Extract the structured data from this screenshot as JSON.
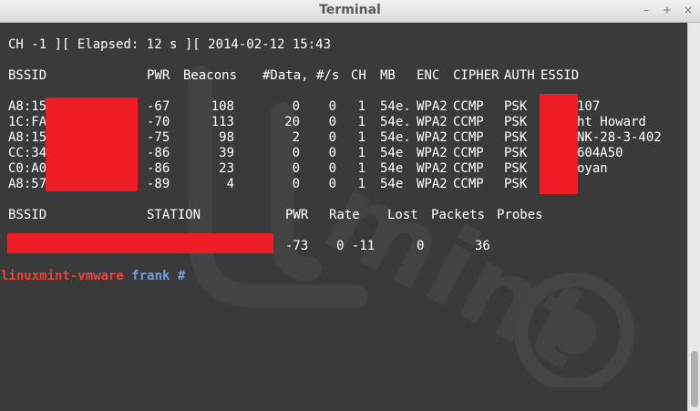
{
  "window": {
    "title": "Terminal",
    "buttons": {
      "minimize": "–",
      "maximize": "+",
      "close": "×"
    }
  },
  "terminal": {
    "status_line": "CH -1 ][ Elapsed: 12 s ][ 2014-02-12 15:43",
    "ap_headers": [
      "BSSID",
      "PWR",
      "Beacons",
      "#Data, #/s",
      "CH",
      "MB",
      "ENC",
      "CIPHER",
      "AUTH",
      "ESSID"
    ],
    "ap_rows": [
      {
        "bssid": "A8:15",
        "pwr": "-67",
        "beacons": "108",
        "data": "0",
        "per_s": "0",
        "ch": "1",
        "mb": "54e.",
        "enc": "WPA2",
        "cipher": "CCMP",
        "auth": "PSK",
        "essid": "107"
      },
      {
        "bssid": "1C:FA",
        "pwr": "-70",
        "beacons": "113",
        "data": "20",
        "per_s": "0",
        "ch": "1",
        "mb": "54e.",
        "enc": "WPA2",
        "cipher": "CCMP",
        "auth": "PSK",
        "essid": "ht Howard"
      },
      {
        "bssid": "A8:15",
        "pwr": "-75",
        "beacons": "98",
        "data": "2",
        "per_s": "0",
        "ch": "1",
        "mb": "54e.",
        "enc": "WPA2",
        "cipher": "CCMP",
        "auth": "PSK",
        "essid": "NK-28-3-402"
      },
      {
        "bssid": "CC:34",
        "pwr": "-86",
        "beacons": "39",
        "data": "0",
        "per_s": "0",
        "ch": "1",
        "mb": "54e",
        "enc": "WPA2",
        "cipher": "CCMP",
        "auth": "PSK",
        "essid": "604A50"
      },
      {
        "bssid": "C0:A0",
        "pwr": "-86",
        "beacons": "23",
        "data": "0",
        "per_s": "0",
        "ch": "1",
        "mb": "54e",
        "enc": "WPA2",
        "cipher": "CCMP",
        "auth": "PSK",
        "essid": "oyan"
      },
      {
        "bssid": "A8:57",
        "pwr": "-89",
        "beacons": "4",
        "data": "0",
        "per_s": "0",
        "ch": "1",
        "mb": "54e",
        "enc": "WPA2",
        "cipher": "CCMP",
        "auth": "PSK",
        "essid": ""
      }
    ],
    "station_headers": [
      "BSSID",
      "STATION",
      "PWR",
      "Rate",
      "Lost",
      "Packets",
      "Probes"
    ],
    "station_row": {
      "pwr": "-73",
      "rate": "0 -11",
      "lost": "0",
      "packets": "36",
      "probes": ""
    },
    "prompt": {
      "host": "linuxmint-vmware",
      "dir": "frank",
      "symbol": "#"
    }
  },
  "colors": {
    "background": "#3a3a3a",
    "text": "#ffffff",
    "redaction": "#ee1c25",
    "prompt_host": "#e8423c",
    "prompt_dir": "#6f9fd8"
  }
}
